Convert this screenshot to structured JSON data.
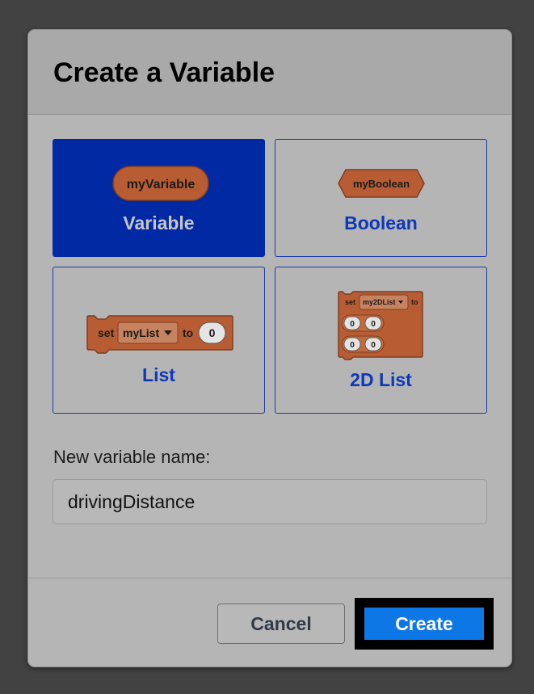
{
  "dialog": {
    "title": "Create a Variable",
    "types": [
      {
        "label": "Variable",
        "block_text": "myVariable",
        "selected": true
      },
      {
        "label": "Boolean",
        "block_text": "myBoolean",
        "selected": false
      },
      {
        "label": "List",
        "block_set": "set",
        "block_name": "myList",
        "block_to": "to",
        "block_value": "0",
        "selected": false
      },
      {
        "label": "2D List",
        "block_set": "set",
        "block_name": "my2DList",
        "block_to": "to",
        "cells": [
          "0",
          "0",
          "0",
          "0"
        ],
        "selected": false
      }
    ],
    "field_label": "New variable name:",
    "field_value": "drivingDistance",
    "cancel_label": "Cancel",
    "create_label": "Create"
  },
  "colors": {
    "selected_card": "#0029a3",
    "accent_text": "#0d38b8",
    "block_fill": "#b85d33",
    "create_button": "#0d77e6"
  }
}
